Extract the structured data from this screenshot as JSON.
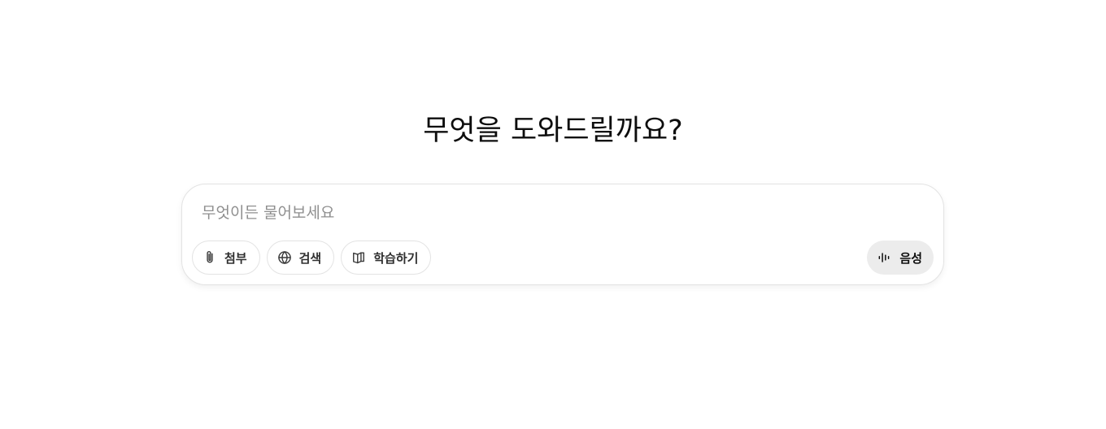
{
  "headline": "무엇을 도와드릴까요?",
  "composer": {
    "value": "",
    "placeholder": "무엇이든 물어보세요",
    "tools": [
      {
        "label": "첨부",
        "icon": "paperclip-icon"
      },
      {
        "label": "검색",
        "icon": "globe-icon"
      },
      {
        "label": "학습하기",
        "icon": "book-icon"
      }
    ],
    "voice": {
      "label": "음성",
      "icon": "voice-waveform-icon"
    }
  },
  "colors": {
    "text": "#0d0d0d",
    "placeholder": "#8f8f8f",
    "border": "#e3e3e3",
    "voice_bg": "#ececec",
    "background": "#ffffff"
  }
}
